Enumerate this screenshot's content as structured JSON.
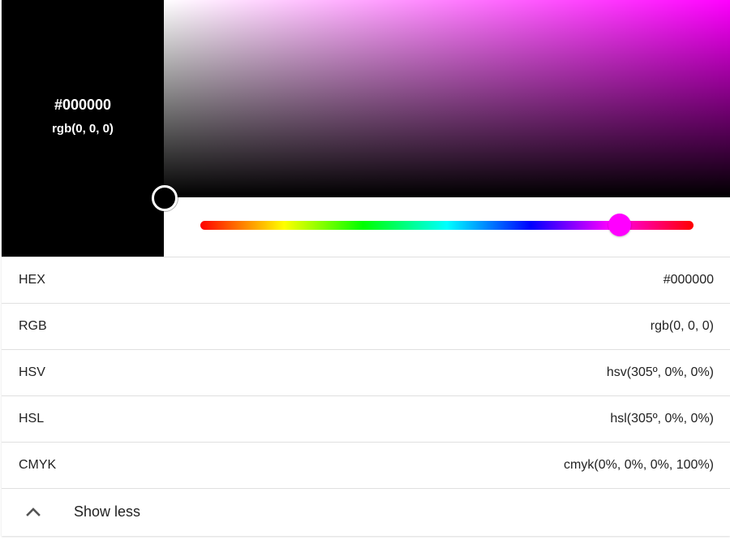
{
  "color": {
    "current_hex": "#000000",
    "hue_hex": "#ff00ff"
  },
  "preview": {
    "hex_text": "#000000",
    "rgb_text": "rgb(0, 0, 0)"
  },
  "hue_slider": {
    "hue_degrees": 305
  },
  "formats": [
    {
      "label": "HEX",
      "value": "#000000"
    },
    {
      "label": "RGB",
      "value": "rgb(0, 0, 0)"
    },
    {
      "label": "HSV",
      "value": "hsv(305º, 0%, 0%)"
    },
    {
      "label": "HSL",
      "value": "hsl(305º, 0%, 0%)"
    },
    {
      "label": "CMYK",
      "value": "cmyk(0%, 0%, 0%, 100%)"
    }
  ],
  "toggle": {
    "label": "Show less",
    "icon": "chevron-up-icon"
  }
}
